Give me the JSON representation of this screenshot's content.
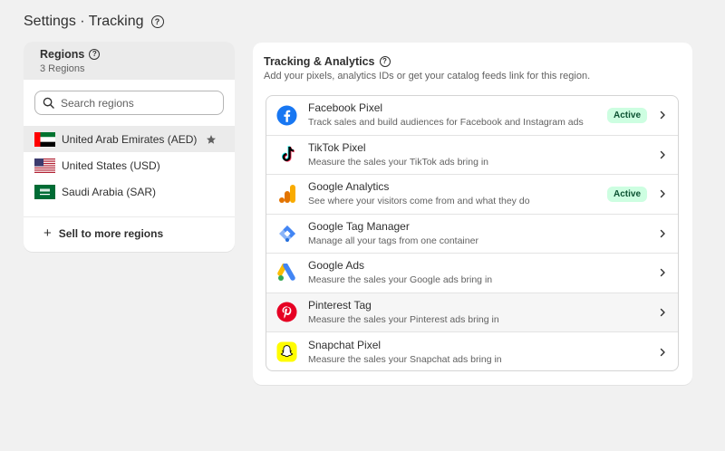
{
  "page": {
    "title": "Settings · Tracking"
  },
  "regions": {
    "title": "Regions",
    "count": "3 Regions",
    "search_placeholder": "Search regions",
    "items": [
      {
        "label": "United Arab Emirates (AED)",
        "flag": "uae-flag",
        "selected": true,
        "default": true
      },
      {
        "label": "United States (USD)",
        "flag": "us-flag",
        "selected": false
      },
      {
        "label": "Saudi Arabia (SAR)",
        "flag": "saudi-flag",
        "selected": false
      }
    ],
    "sell_more_label": "Sell to more regions"
  },
  "tracking": {
    "title": "Tracking & Analytics",
    "description": "Add your pixels, analytics IDs or get your catalog feeds link for this region.",
    "integrations": [
      {
        "name": "Facebook Pixel",
        "description": "Track sales and build audiences for Facebook and Instagram ads",
        "status": "Active",
        "icon": "facebook-icon"
      },
      {
        "name": "TikTok Pixel",
        "description": "Measure the sales your TikTok ads bring in",
        "status": "",
        "icon": "tiktok-icon"
      },
      {
        "name": "Google Analytics",
        "description": "See where your visitors come from and what they do",
        "status": "Active",
        "icon": "google-analytics-icon"
      },
      {
        "name": "Google Tag Manager",
        "description": "Manage all your tags from one container",
        "status": "",
        "icon": "google-tag-manager-icon"
      },
      {
        "name": "Google Ads",
        "description": "Measure the sales your Google ads bring in",
        "status": "",
        "icon": "google-ads-icon"
      },
      {
        "name": "Pinterest Tag",
        "description": "Measure the sales your Pinterest ads bring in",
        "status": "",
        "icon": "pinterest-icon"
      },
      {
        "name": "Snapchat Pixel",
        "description": "Measure the sales your Snapchat ads bring in",
        "status": "",
        "icon": "snapchat-icon"
      }
    ]
  },
  "colors": {
    "background": "#f1f1f1",
    "active_badge_bg": "#cdfee1",
    "active_badge_text": "#0c5132",
    "facebook": "#1877f2",
    "pinterest": "#e60023",
    "snapchat": "#fffc00"
  }
}
